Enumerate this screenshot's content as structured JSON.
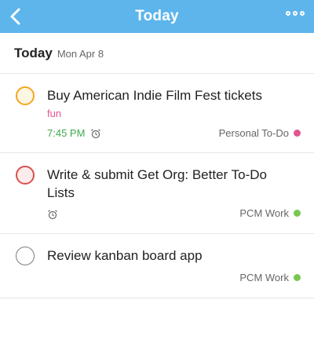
{
  "header": {
    "title": "Today",
    "back_icon": "chevron-left-icon",
    "more_icon": "more-dots-icon",
    "bg_color": "#5db5ec"
  },
  "date_header": {
    "label": "Today",
    "date": "Mon Apr 8"
  },
  "tasks": [
    {
      "title": "Buy American Indie Film Fest tickets",
      "tag": "fun",
      "time": "7:45 PM",
      "list": "Personal To-Do",
      "list_color": "#e35590",
      "circle_color": "#f5a623",
      "circle_fill": "#fdf6e3"
    },
    {
      "title": "Write & submit Get Org: Better To-Do Lists",
      "tag": "",
      "time": "",
      "list": "PCM Work",
      "list_color": "#78c850",
      "circle_color": "#d9504f",
      "circle_fill": "#fbeceb"
    },
    {
      "title": "Review kanban board app",
      "tag": "",
      "time": "",
      "list": "PCM Work",
      "list_color": "#78c850",
      "circle_color": "#7b7b7b",
      "circle_fill": "#ffffff"
    }
  ]
}
